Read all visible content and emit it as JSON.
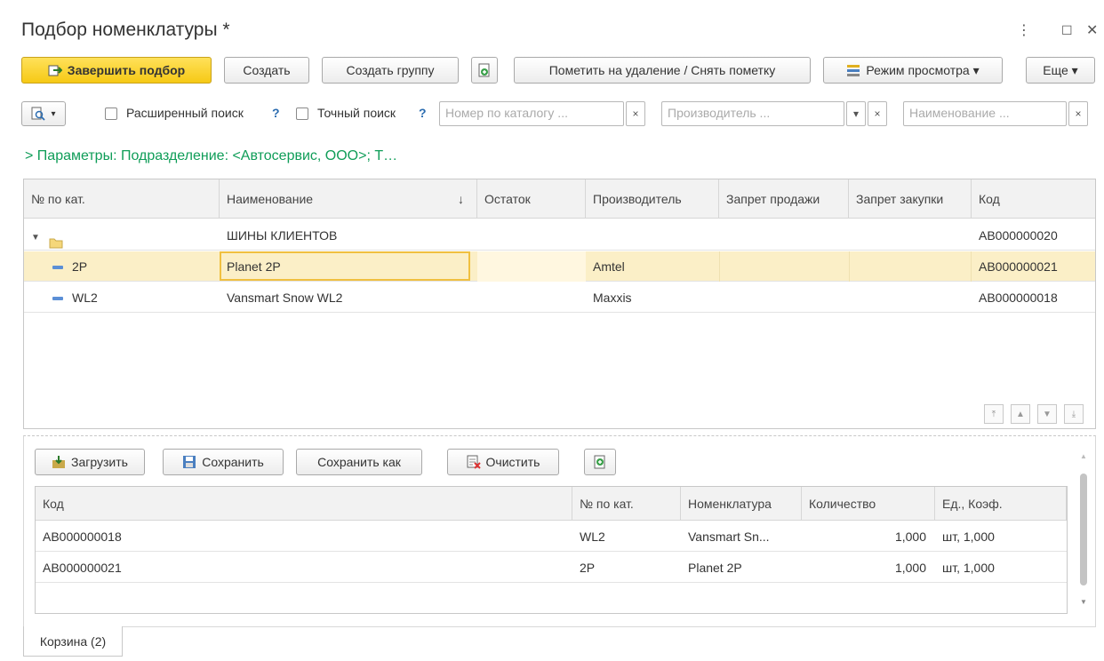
{
  "window": {
    "title": "Подбор номенклатуры *",
    "menu_glyph": "⋮",
    "maximize_glyph": "☐",
    "close_glyph": "✕"
  },
  "toolbar": {
    "finish_label": "Завершить подбор",
    "create_label": "Создать",
    "create_group_label": "Создать группу",
    "mark_delete_label": "Пометить на удаление / Снять пометку",
    "view_mode_label": "Режим просмотра ▾",
    "more_label": "Еще ▾"
  },
  "search": {
    "extended_label": "Расширенный поиск",
    "exact_label": "Точный поиск",
    "help_glyph": "?",
    "catalog_placeholder": "Номер по каталогу ...",
    "manufacturer_placeholder": "Производитель ...",
    "name_placeholder": "Наименование ...",
    "clear_glyph": "×",
    "dropdown_glyph": "▾"
  },
  "params_text": "> Параметры: Подразделение: <Автосервис, ООО>; Т…",
  "catalog_table": {
    "columns": [
      "№ по кат.",
      "Наименование",
      "Остаток",
      "Производитель",
      "Запрет продажи",
      "Запрет закупки",
      "Код"
    ],
    "sort_glyph": "↓",
    "group_row": {
      "name": "ШИНЫ КЛИЕНТОВ",
      "code": "АВ000000020"
    },
    "rows": [
      {
        "num": "2P",
        "name": "Planet 2P",
        "stock": "",
        "manufacturer": "Amtel",
        "no_sale": "",
        "no_purchase": "",
        "code": "АВ000000021"
      },
      {
        "num": "WL2",
        "name": "Vansmart Snow WL2",
        "stock": "",
        "manufacturer": "Maxxis",
        "no_sale": "",
        "no_purchase": "",
        "code": "АВ000000018"
      }
    ],
    "nav": [
      "⤒",
      "▲",
      "▼",
      "⤓"
    ]
  },
  "cart_toolbar": {
    "load_label": "Загрузить",
    "save_label": "Сохранить",
    "save_as_label": "Сохранить как",
    "clear_label": "Очистить"
  },
  "cart_table": {
    "columns": [
      "Код",
      "№ по кат.",
      "Номенклатура",
      "Количество",
      "Ед., Коэф."
    ],
    "rows": [
      {
        "code": "АВ000000018",
        "num": "WL2",
        "item": "Vansmart Sn...",
        "qty": "1,000",
        "unit": "шт, 1,000"
      },
      {
        "code": "АВ000000021",
        "num": "2P",
        "item": "Planet 2P",
        "qty": "1,000",
        "unit": "шт, 1,000"
      }
    ]
  },
  "tabs": {
    "cart_label": "Корзина (2)"
  },
  "colors": {
    "accent_yellow": "#f6c915",
    "params_green": "#0f9d58",
    "selected_row": "#fbefc7"
  }
}
